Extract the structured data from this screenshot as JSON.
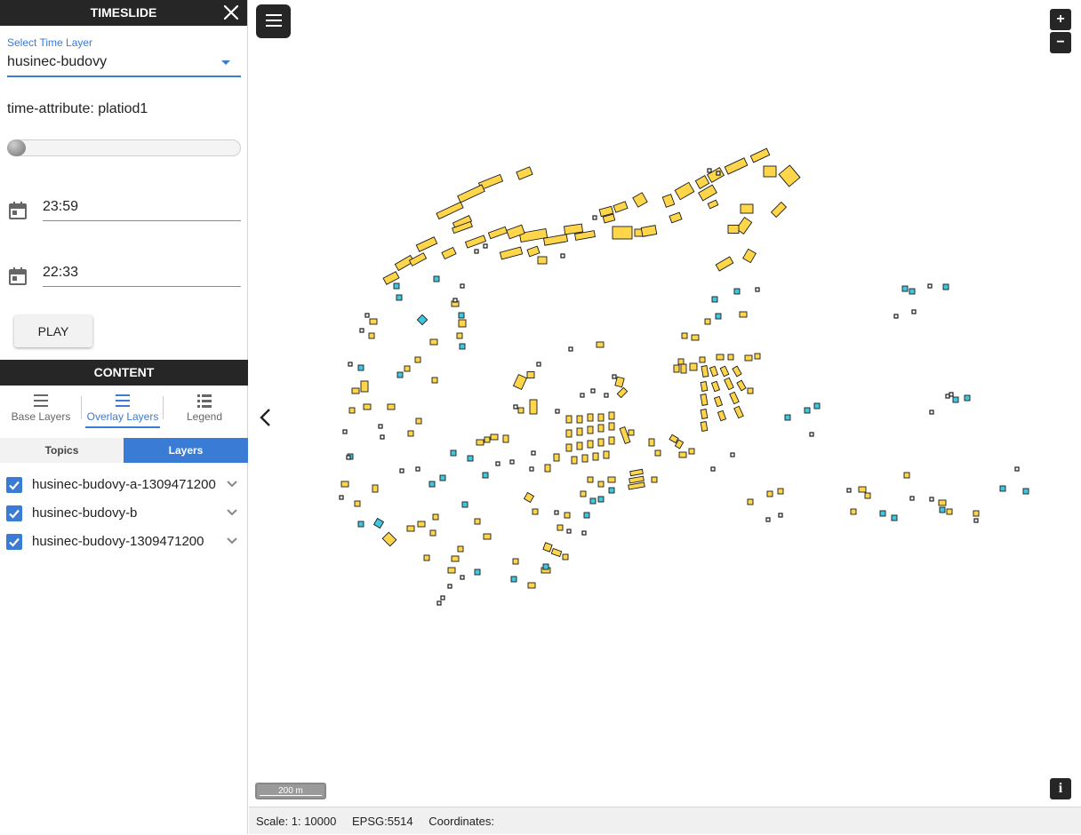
{
  "sidebar": {
    "title": "TIMESLIDE",
    "close_icon": "close-icon",
    "select_label": "Select Time Layer",
    "select_value": "husinec-budovy",
    "time_attribute": "time-attribute: platiod1",
    "slider_fraction": 0,
    "date_start": "23:59",
    "date_end": "22:33",
    "play_label": "PLAY"
  },
  "content": {
    "title": "CONTENT",
    "tabs": [
      {
        "label": "Base Layers",
        "icon": "stack-lines-icon"
      },
      {
        "label": "Overlay Layers",
        "icon": "stack-lines-icon"
      },
      {
        "label": "Legend",
        "icon": "list-icon"
      }
    ],
    "active_tab": "Overlay Layers",
    "subtabs": [
      {
        "label": "Topics"
      },
      {
        "label": "Layers"
      }
    ],
    "active_subtab": "Layers",
    "layers": [
      {
        "name": "husinec-budovy-a-1309471200",
        "checked": true
      },
      {
        "name": "husinec-budovy-b",
        "checked": true
      },
      {
        "name": "husinec-budovy-1309471200",
        "checked": true
      }
    ]
  },
  "map": {
    "zoom_in": "+",
    "zoom_out": "−",
    "scale_bar": "200 m",
    "info": "i",
    "status": {
      "scale": "Scale: 1: 10000",
      "projection": "EPSG:5514",
      "coordinates": "Coordinates:"
    },
    "colors": {
      "building_fill": "#ffd64a",
      "small_fill": "#40c7e0",
      "outline": "#1a1a1a",
      "accent": "#3a7bd5",
      "dark": "#262626"
    }
  }
}
